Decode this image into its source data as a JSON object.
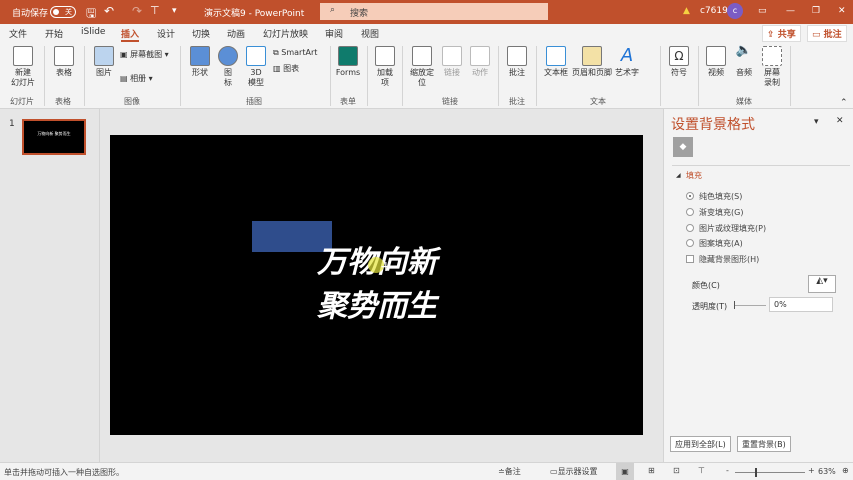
{
  "titlebar": {
    "autosave": "自动保存",
    "toggle": "关",
    "doc_title": "演示文稿9  -  PowerPoint",
    "search": "搜索",
    "user": "c7619",
    "avatar": "c",
    "bg": "#c0502c"
  },
  "tabs": [
    "文件",
    "开始",
    "iSlide",
    "插入",
    "设计",
    "切换",
    "动画",
    "幻灯片放映",
    "审阅",
    "视图"
  ],
  "active_tab": "插入",
  "share": "共享",
  "comment": "批注",
  "ribbon": {
    "new_slide": "新建\n幻灯片",
    "table": "表格",
    "picture": "图片",
    "screenshot": "屏幕截图",
    "album": "相册",
    "shapes": "形状",
    "icons": "图\n标",
    "model3d": "3D\n模型",
    "smartart": "SmartArt",
    "chart": "图表",
    "forms": "Forms",
    "addins": "加载\n项",
    "zoom": "缩放定\n位",
    "link": "链接",
    "action": "动作",
    "comment": "批注",
    "textbox": "文本框",
    "headerfooter": "页眉和页脚",
    "wordart": "艺术字",
    "symbol": "符号",
    "video": "视频",
    "audio": "音频",
    "screenrec": "屏幕\n录制",
    "groups": [
      "幻灯片",
      "表格",
      "图像",
      "插图",
      "表单",
      "链接",
      "批注",
      "文本",
      "媒体"
    ]
  },
  "thumbnail": {
    "number": "1",
    "text": "万物向新 聚势而生"
  },
  "slide": {
    "line1": "万物向新",
    "line2": "聚势而生",
    "shape_color": "#2f4d8c"
  },
  "pane": {
    "title": "设置背景格式",
    "section": "填充",
    "options": [
      "纯色填充(S)",
      "渐变填充(G)",
      "图片或纹理填充(P)",
      "图案填充(A)"
    ],
    "selected": "纯色填充(S)",
    "hide_bg": "隐藏背景图形(H)",
    "color_label": "颜色(C)",
    "transparency_label": "透明度(T)",
    "transparency_value": "0%",
    "apply_all": "应用到全部(L)",
    "reset": "重置背景(B)"
  },
  "status": {
    "hint": "单击并拖动可插入一种自选图形。",
    "notes": "备注",
    "display": "显示器设置",
    "zoom": "63%"
  }
}
